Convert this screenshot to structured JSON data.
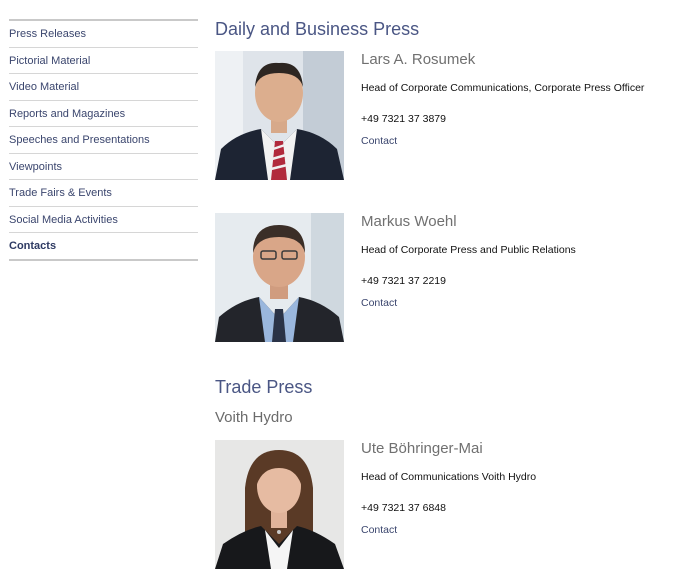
{
  "sidebar": {
    "items": [
      {
        "label": "Press Releases"
      },
      {
        "label": "Pictorial Material"
      },
      {
        "label": "Video Material"
      },
      {
        "label": "Reports and Magazines"
      },
      {
        "label": "Speeches and Presentations"
      },
      {
        "label": "Viewpoints"
      },
      {
        "label": "Trade Fairs & Events"
      },
      {
        "label": "Social Media Activities"
      },
      {
        "label": "Contacts"
      }
    ]
  },
  "main": {
    "section1": {
      "title": "Daily and Business Press",
      "people": [
        {
          "name": "Lars A. Rosumek",
          "role": "Head of Corporate Communications, Corporate Press Officer",
          "phone": "+49 7321 37 3879",
          "contact": "Contact"
        },
        {
          "name": "Markus Woehl",
          "role": "Head of Corporate Press and Public Relations",
          "phone": "+49 7321 37 2219",
          "contact": "Contact"
        }
      ]
    },
    "section2": {
      "title": "Trade Press",
      "subtitle": "Voith Hydro",
      "people": [
        {
          "name": "Ute Böhringer-Mai",
          "role": "Head of Communications Voith Hydro",
          "phone": "+49 7321 37 6848",
          "contact": "Contact"
        }
      ]
    }
  },
  "colors": {
    "link": "#3b466e",
    "heading": "#4a5684",
    "name": "#707070"
  }
}
